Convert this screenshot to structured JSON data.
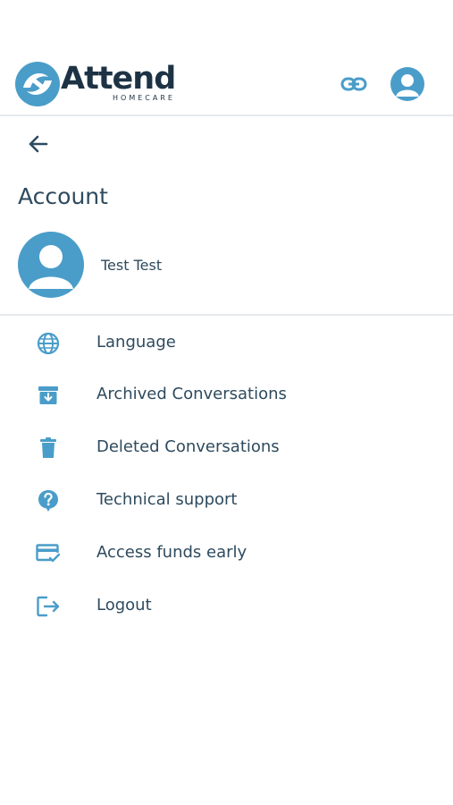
{
  "brand": {
    "name": "Attend",
    "sub": "HOMECARE",
    "accent": "#4a9dc9",
    "dark": "#1d3345"
  },
  "header": {
    "link_icon": "link-icon",
    "avatar_icon": "user-avatar-icon"
  },
  "page": {
    "back_icon": "arrow-left-icon",
    "title": "Account"
  },
  "profile": {
    "name": "Test Test",
    "avatar_icon": "user-avatar-icon"
  },
  "menu": {
    "items": [
      {
        "label": "Language",
        "icon": "globe-icon"
      },
      {
        "label": "Archived Conversations",
        "icon": "archive-icon"
      },
      {
        "label": "Deleted Conversations",
        "icon": "trash-icon"
      },
      {
        "label": "Technical support",
        "icon": "help-icon"
      },
      {
        "label": "Access funds early",
        "icon": "card-check-icon"
      },
      {
        "label": "Logout",
        "icon": "logout-icon"
      }
    ]
  }
}
